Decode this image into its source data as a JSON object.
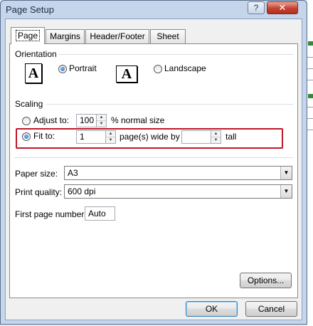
{
  "window": {
    "title": "Page Setup",
    "help_label": "?",
    "close_label": "✕"
  },
  "tabs": [
    {
      "label": "Page",
      "active": true
    },
    {
      "label": "Margins",
      "active": false
    },
    {
      "label": "Header/Footer",
      "active": false
    },
    {
      "label": "Sheet",
      "active": false
    }
  ],
  "orientation": {
    "label": "Orientation",
    "icon_glyph": "A",
    "portrait": {
      "label": "Portrait",
      "selected": true
    },
    "landscape": {
      "label": "Landscape",
      "selected": false
    }
  },
  "scaling": {
    "label": "Scaling",
    "adjust_to": {
      "label": "Adjust to:",
      "value": "100",
      "suffix": "% normal size",
      "selected": false
    },
    "fit_to": {
      "label": "Fit to:",
      "wide_value": "1",
      "wide_suffix": "page(s) wide by",
      "tall_value": "",
      "tall_suffix": "tall",
      "selected": true
    }
  },
  "paper_size": {
    "label": "Paper size:",
    "value": "A3"
  },
  "print_quality": {
    "label": "Print quality:",
    "value": "600 dpi"
  },
  "first_page_number": {
    "label": "First page number:",
    "value": "Auto"
  },
  "buttons": {
    "options": "Options...",
    "ok": "OK",
    "cancel": "Cancel"
  },
  "colors": {
    "highlight": "#c0182a",
    "accent": "#1a5fb4",
    "close": "#c7412f"
  }
}
